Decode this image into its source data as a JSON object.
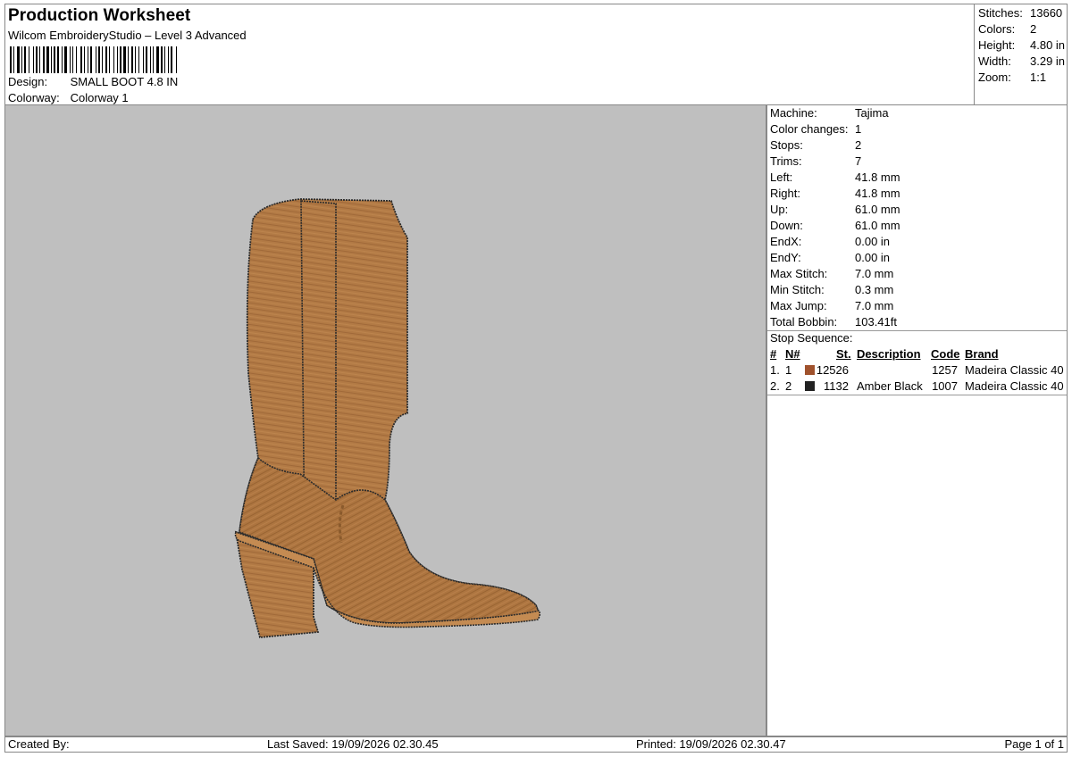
{
  "header": {
    "title": "Production Worksheet",
    "software": "Wilcom EmbroideryStudio – Level 3 Advanced",
    "design_label": "Design:",
    "design_value": "SMALL BOOT 4.8 IN",
    "colorway_label": "Colorway:",
    "colorway_value": "Colorway 1"
  },
  "summary": {
    "stitches_label": "Stitches:",
    "stitches_value": "13660",
    "colors_label": "Colors:",
    "colors_value": "2",
    "height_label": "Height:",
    "height_value": "4.80 in",
    "width_label": "Width:",
    "width_value": "3.29 in",
    "zoom_label": "Zoom:",
    "zoom_value": "1:1"
  },
  "machine": {
    "rows": [
      {
        "label": "Machine:",
        "value": "Tajima"
      },
      {
        "label": "Color changes:",
        "value": "1"
      },
      {
        "label": "Stops:",
        "value": "2"
      },
      {
        "label": "Trims:",
        "value": "7"
      },
      {
        "label": "Left:",
        "value": "41.8 mm"
      },
      {
        "label": "Right:",
        "value": "41.8 mm"
      },
      {
        "label": "Up:",
        "value": "61.0 mm"
      },
      {
        "label": "Down:",
        "value": "61.0 mm"
      },
      {
        "label": "EndX:",
        "value": "0.00 in"
      },
      {
        "label": "EndY:",
        "value": "0.00 in"
      },
      {
        "label": "Max Stitch:",
        "value": "7.0 mm"
      },
      {
        "label": "Min Stitch:",
        "value": "0.3 mm"
      },
      {
        "label": "Max Jump:",
        "value": "7.0 mm"
      },
      {
        "label": "Total Bobbin:",
        "value": "103.41ft"
      }
    ]
  },
  "stop_sequence": {
    "title": "Stop Sequence:",
    "headers": {
      "num": "#",
      "needle": "N#",
      "stitches": "St.",
      "description": "Description",
      "code": "Code",
      "brand": "Brand"
    },
    "rows": [
      {
        "num": "1.",
        "needle": "1",
        "color": "#a0522d",
        "stitches": "12526",
        "description": "",
        "code": "1257",
        "brand": "Madeira Classic 40"
      },
      {
        "num": "2.",
        "needle": "2",
        "color": "#222222",
        "stitches": "1132",
        "description": "Amber Black",
        "code": "1007",
        "brand": "Madeira Classic 40"
      }
    ]
  },
  "footer": {
    "created_by": "Created By:",
    "last_saved": "Last Saved: 19/09/2026 02.30.45",
    "printed": "Printed: 19/09/2026 02.30.47",
    "page": "Page 1 of 1"
  },
  "colors": {
    "boot_fill": "#b27a45",
    "boot_outline": "#2b2b2b",
    "canvas_bg": "#bfbfbf"
  }
}
